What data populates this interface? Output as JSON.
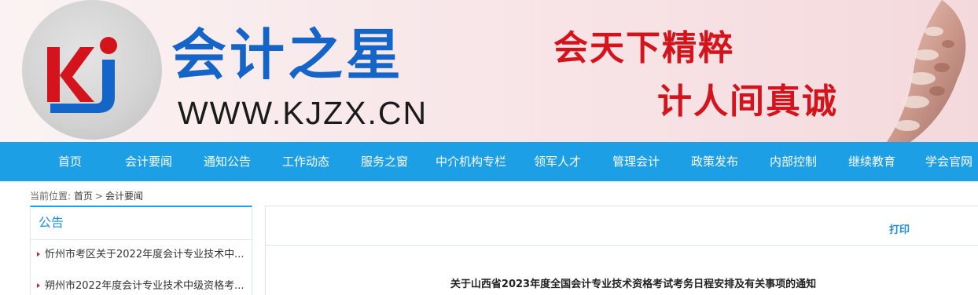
{
  "header": {
    "brand_name": "会计之星",
    "brand_url": "WWW.KJZX.CN",
    "slogan_line1": "会天下精粹",
    "slogan_line2": "计人间真诚",
    "logo_letters": "kj",
    "colors": {
      "brand_blue": "#1565c8",
      "logo_red": "#d4141c",
      "slogan_red": "#d4141c"
    }
  },
  "nav": {
    "background": "#1d9fe6",
    "items": [
      {
        "label": "首页"
      },
      {
        "label": "会计要闻"
      },
      {
        "label": "通知公告"
      },
      {
        "label": "工作动态"
      },
      {
        "label": "服务之窗"
      },
      {
        "label": "中介机构专栏"
      },
      {
        "label": "领军人才"
      },
      {
        "label": "管理会计"
      },
      {
        "label": "政策发布"
      },
      {
        "label": "内部控制"
      },
      {
        "label": "继续教育"
      },
      {
        "label": "学会官网"
      }
    ]
  },
  "breadcrumb": {
    "prefix": "当前位置:",
    "home": "首页",
    "separator": ">",
    "current": "会计要闻"
  },
  "sidebar": {
    "title": "公告",
    "items": [
      {
        "label": "忻州市考区关于2022年度会计专业技术中..."
      },
      {
        "label": "朔州市2022年度会计专业技术中级资格考..."
      }
    ]
  },
  "article": {
    "print_label": "打印",
    "title": "关于山西省2023年度全国会计专业技术资格考试考务日程安排及有关事项的通知"
  }
}
